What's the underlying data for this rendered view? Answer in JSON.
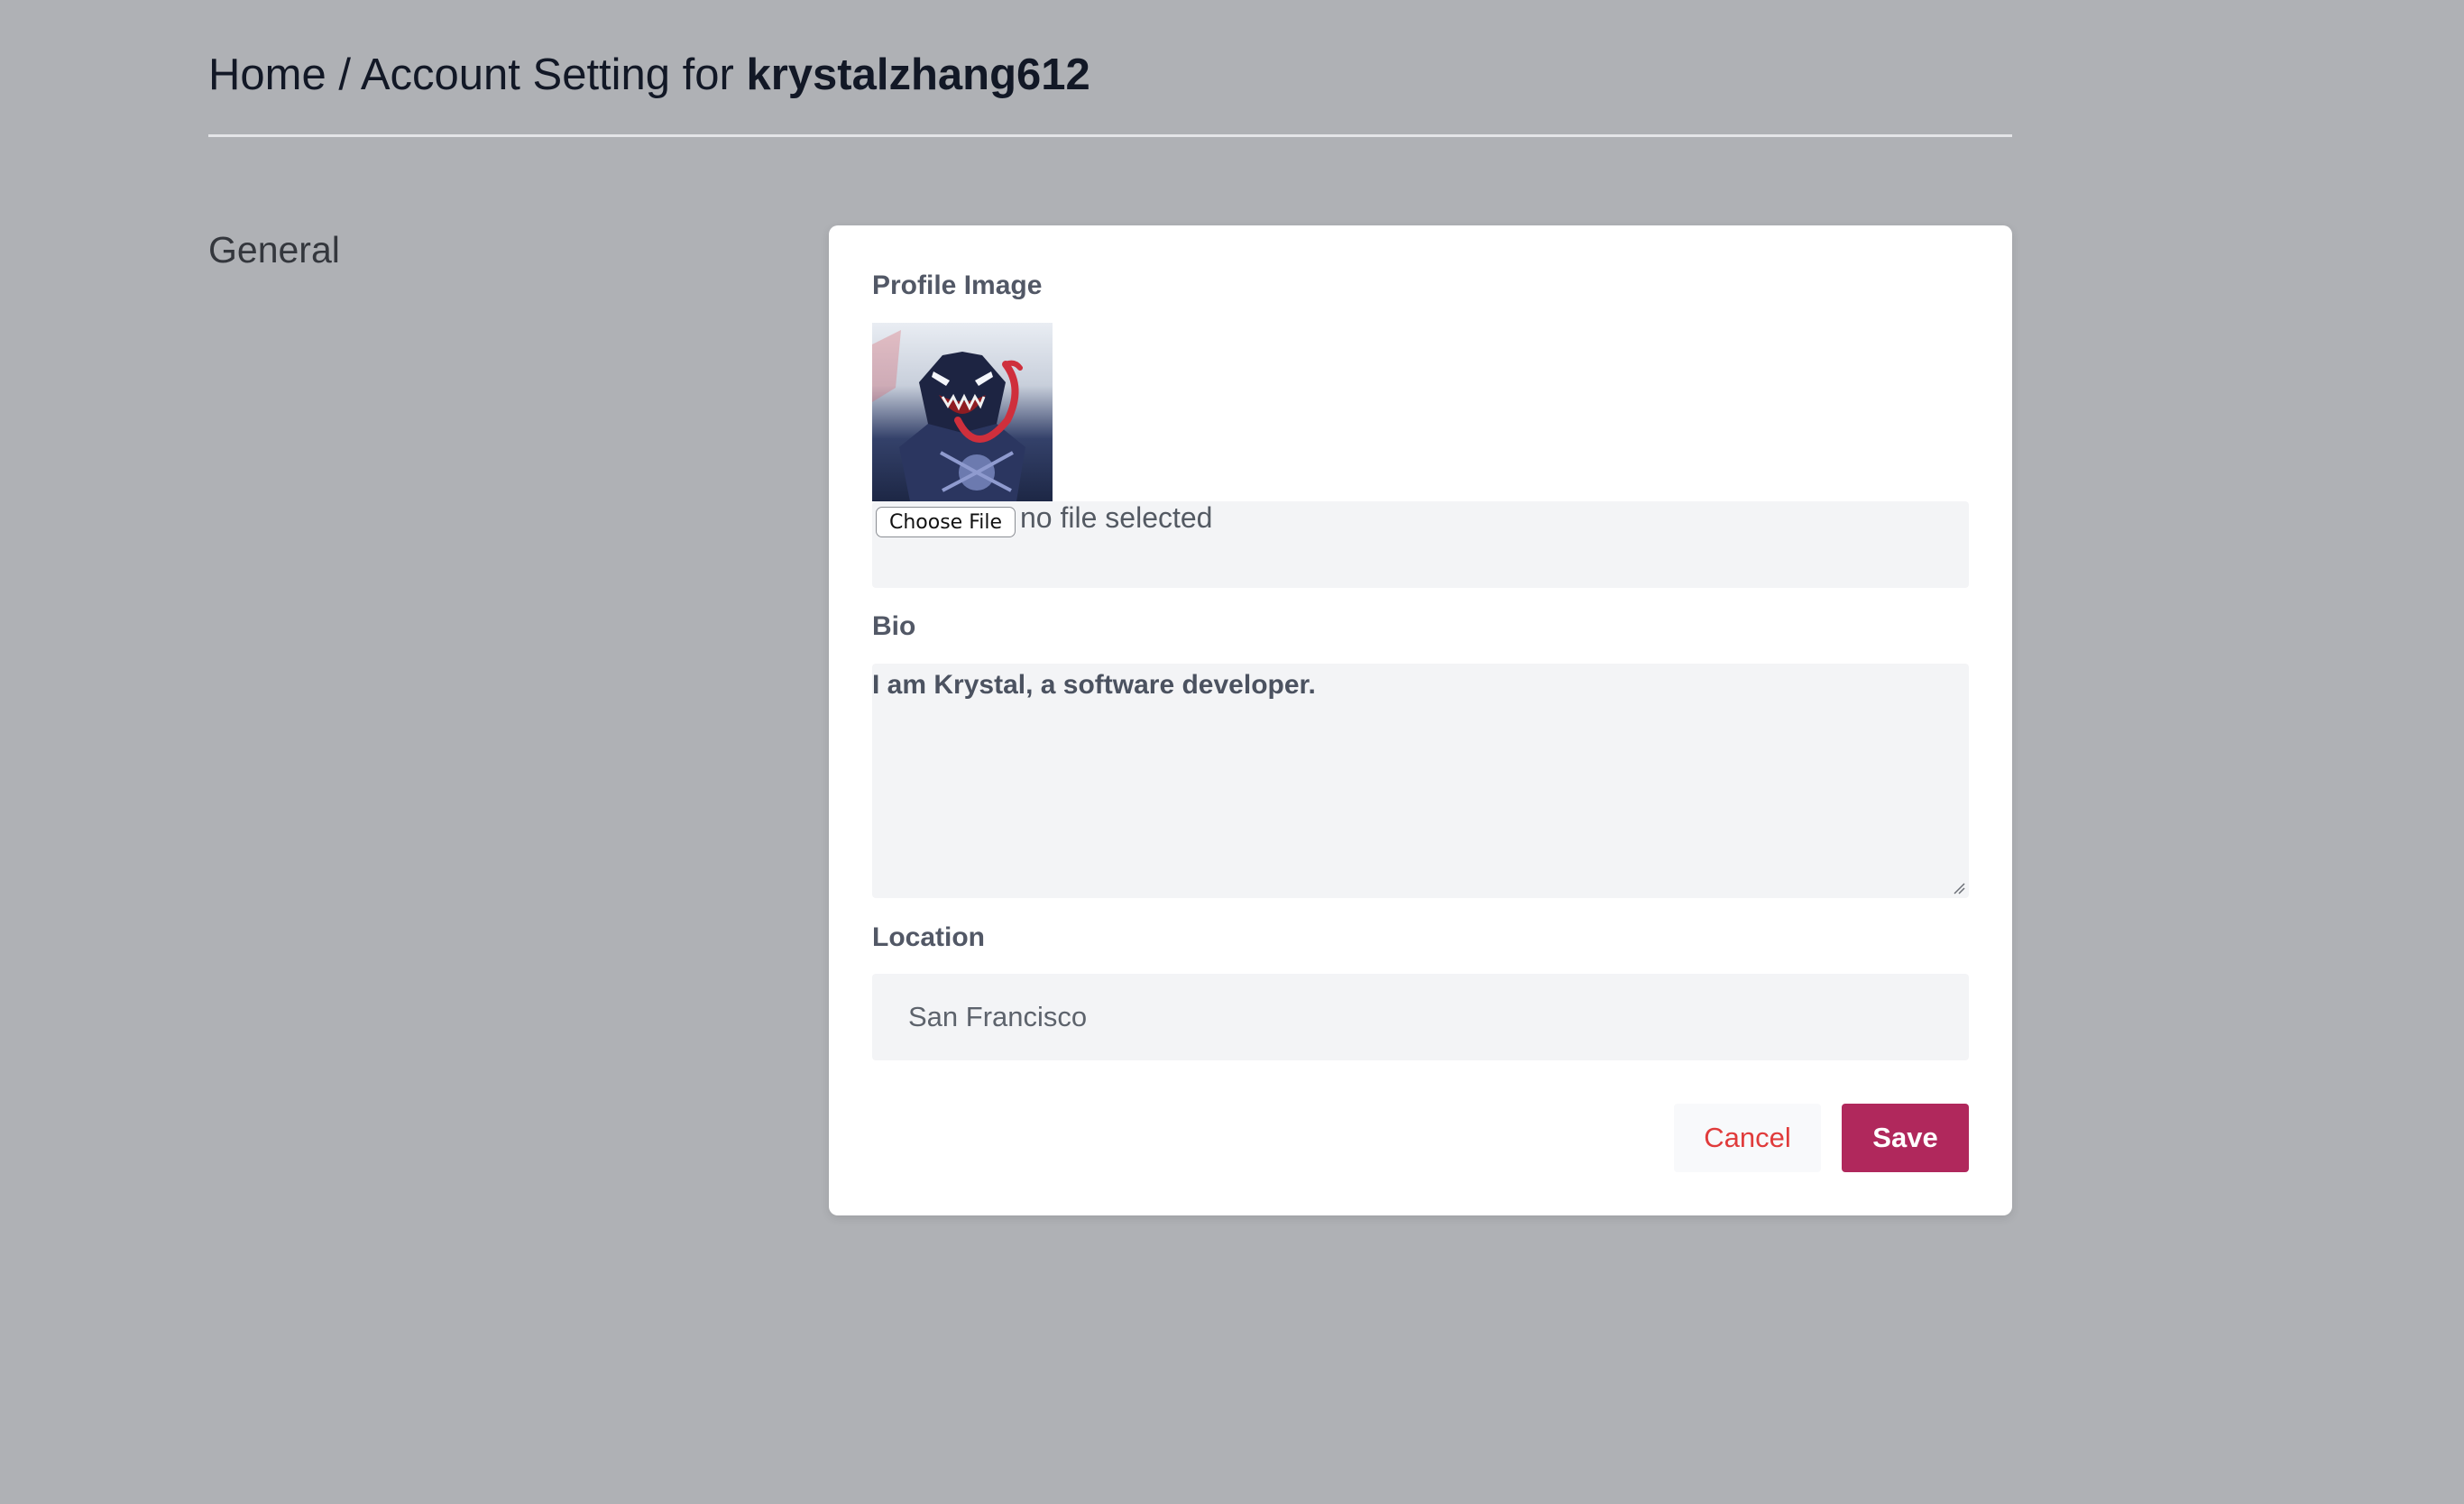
{
  "header": {
    "breadcrumb_prefix": "Home / Account Setting for ",
    "username": "krystalzhang612"
  },
  "section": {
    "title": "General"
  },
  "form": {
    "profile_image_label": "Profile Image",
    "choose_file_label": "Choose File",
    "file_status": "no file selected",
    "bio_label": "Bio",
    "bio_value": "I am Krystal, a software developer.",
    "location_label": "Location",
    "location_value": "San Francisco",
    "cancel_label": "Cancel",
    "save_label": "Save"
  },
  "colors": {
    "page_background": "#afb1b5",
    "card_background": "#ffffff",
    "accent": "#b0285c",
    "cancel_text": "#e03b3b"
  },
  "icons": {
    "avatar": "venom-avatar-image",
    "resize": "textarea-resize-grip-icon"
  }
}
